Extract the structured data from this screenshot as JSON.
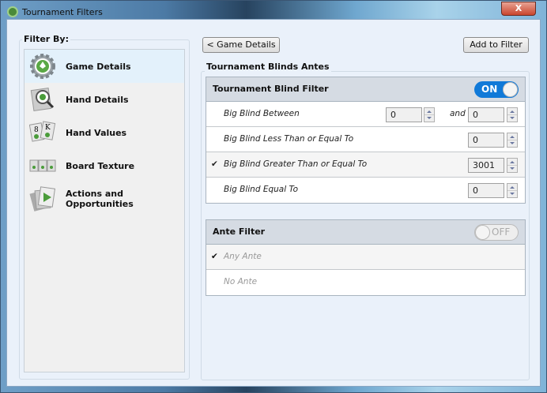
{
  "window": {
    "title": "Tournament Filters",
    "close_label": "X"
  },
  "sidebar": {
    "group_label": "Filter By:",
    "items": [
      {
        "label": "Game Details",
        "icon": "gear-spade-icon",
        "selected": true
      },
      {
        "label": "Hand Details",
        "icon": "magnifier-card-icon"
      },
      {
        "label": "Hand Values",
        "icon": "two-cards-icon"
      },
      {
        "label": "Board Texture",
        "icon": "three-cards-icon"
      },
      {
        "label": "Actions and Opportunities",
        "icon": "cards-arrow-icon"
      }
    ]
  },
  "toolbar": {
    "back_label": "< Game Details",
    "add_label": "Add to Filter"
  },
  "main": {
    "group_label": "Tournament Blinds  Antes",
    "blind_filter": {
      "title": "Tournament Blind Filter",
      "toggle": "ON",
      "rows": [
        {
          "label": "Big Blind Between",
          "value": "0",
          "and_label": "and",
          "value2": "0",
          "checked": false
        },
        {
          "label": "Big Blind Less Than or Equal To",
          "value": "0",
          "checked": false
        },
        {
          "label": "Big Blind Greater Than or Equal To",
          "value": "3001",
          "checked": true
        },
        {
          "label": "Big Blind Equal To",
          "value": "0",
          "checked": false
        }
      ]
    },
    "ante_filter": {
      "title": "Ante Filter",
      "toggle": "OFF",
      "rows": [
        {
          "label": "Any Ante",
          "checked": true
        },
        {
          "label": "No Ante",
          "checked": false
        }
      ]
    },
    "check_mark": "✔"
  },
  "colors": {
    "accent": "#1079d8",
    "header": "#d5dbe3",
    "selected": "#e3f1fb"
  }
}
